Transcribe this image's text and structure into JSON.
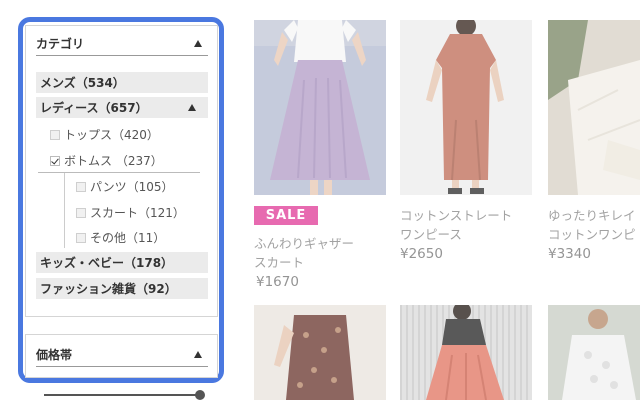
{
  "sidebar": {
    "category_panel": {
      "title": "カテゴリ",
      "categories": [
        {
          "label": "メンズ（534）"
        },
        {
          "label": "レディース（657）"
        },
        {
          "label": "キッズ・ベビー（178）"
        },
        {
          "label": "ファッション雑貨（92）"
        }
      ],
      "ladies_sub": [
        {
          "label": "トップス（420）",
          "checked": false
        },
        {
          "label": "ボトムス （237）",
          "checked": true
        }
      ],
      "bottoms_sub": [
        {
          "label": "パンツ（105）",
          "checked": false
        },
        {
          "label": "スカート（121）",
          "checked": false
        },
        {
          "label": "その他（11）",
          "checked": false
        }
      ]
    },
    "price_panel": {
      "title": "価格帯"
    }
  },
  "products": [
    {
      "badge": "SALE",
      "name_line1": "ふんわりギャザー",
      "name_line2": "スカート",
      "price": "¥1670"
    },
    {
      "name_line1": "コットンストレート",
      "name_line2": "ワンピース",
      "price": "¥2650"
    },
    {
      "name_line1": "ゆったりキレイ",
      "name_line2": "コットンワンピ",
      "price": "¥3340"
    }
  ]
}
